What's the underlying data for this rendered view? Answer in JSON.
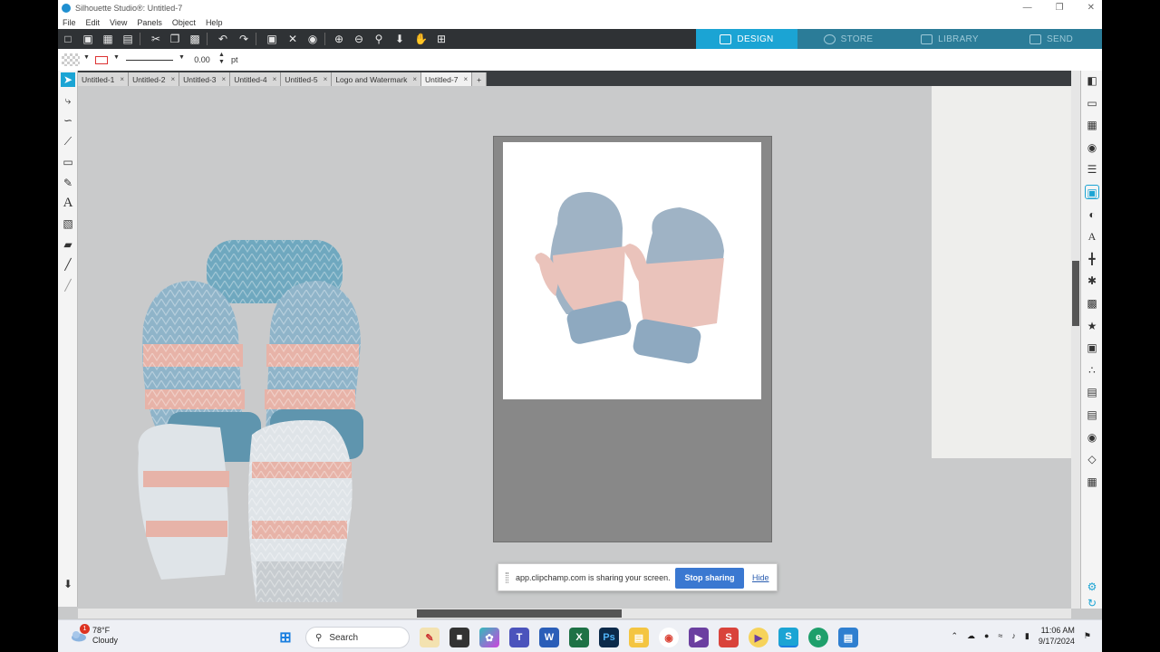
{
  "window": {
    "title": "Silhouette Studio®: Untitled-7",
    "controls": [
      "—",
      "❐",
      "✕"
    ]
  },
  "menu": [
    "File",
    "Edit",
    "View",
    "Panels",
    "Object",
    "Help"
  ],
  "nav_tabs": [
    {
      "label": "DESIGN",
      "icon": "design-grid-icon",
      "active": true
    },
    {
      "label": "STORE",
      "icon": "store-s-icon",
      "active": false
    },
    {
      "label": "LIBRARY",
      "icon": "library-download-icon",
      "active": false
    },
    {
      "label": "SEND",
      "icon": "cutter-send-icon",
      "active": false
    }
  ],
  "line_settings": {
    "width_value": "0.00",
    "unit": "pt"
  },
  "doc_tabs": [
    {
      "label": "Untitled-1",
      "active": false
    },
    {
      "label": "Untitled-2",
      "active": false
    },
    {
      "label": "Untitled-3",
      "active": false
    },
    {
      "label": "Untitled-4",
      "active": false
    },
    {
      "label": "Untitled-5",
      "active": false
    },
    {
      "label": "Logo and Watermark",
      "active": false
    },
    {
      "label": "Untitled-7",
      "active": true
    }
  ],
  "doc_tab_close": "×",
  "doc_tab_add": "+",
  "share_bar": {
    "message": "app.clipchamp.com is sharing your screen.",
    "stop_label": "Stop sharing",
    "hide_label": "Hide"
  },
  "taskbar": {
    "weather_temp": "78°F",
    "weather_text": "Cloudy",
    "search_placeholder": "Search",
    "time": "11:06 AM",
    "date": "9/17/2024",
    "notification_count": "1"
  },
  "colors": {
    "accent": "#1ba4d4",
    "toolbar_bg": "#2f3235",
    "mitten_blue": "#8fb4c9",
    "mitten_pink": "#e7b3a8",
    "mitten_teal": "#6fa8bf",
    "share_button": "#3a78d1"
  }
}
